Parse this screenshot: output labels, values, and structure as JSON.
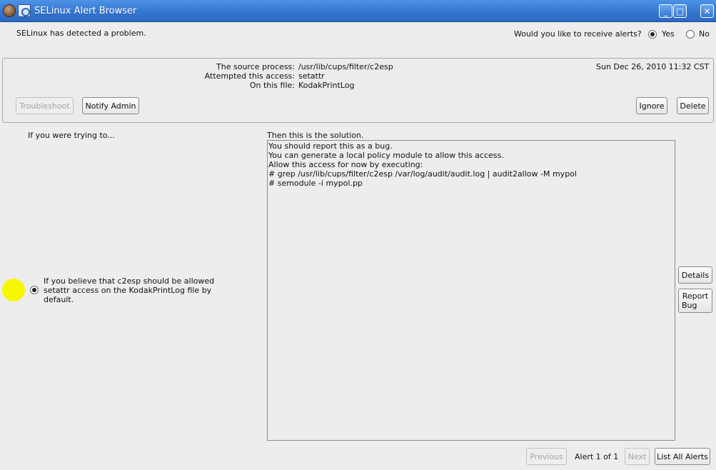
{
  "window": {
    "title": "SELinux Alert Browser",
    "minimize": "_",
    "maximize": "□",
    "close": "✕"
  },
  "header": {
    "detected": "SELinux has detected a problem.",
    "alerts_question": "Would you like to receive alerts?",
    "yes_label": "Yes",
    "no_label": "No",
    "selected": "Yes"
  },
  "alert": {
    "source_label": "The source process:",
    "source_value": "/usr/lib/cups/filter/c2esp",
    "access_label": "Attempted this access:",
    "access_value": "setattr",
    "file_label": "On this file:",
    "file_value": "KodakPrintLog",
    "date": "Sun Dec 26, 2010 11:32 CST"
  },
  "actions": {
    "troubleshoot": "Troubleshoot",
    "notify_admin": "Notify Admin",
    "ignore": "Ignore",
    "delete": "Delete"
  },
  "plugin": {
    "trying_label": "If you were trying to...",
    "solution_label": "Then this is the solution.",
    "reason": "If you believe that c2esp should be allowed setattr access on the KodakPrintLog file by default.",
    "solution_lines": [
      "You should report this as a bug.",
      "You can generate a local policy module to allow this access.",
      "Allow this access for now by executing:",
      "# grep /usr/lib/cups/filter/c2esp /var/log/audit/audit.log | audit2allow -M mypol",
      "# semodule -i mypol.pp"
    ],
    "details": "Details",
    "report_bug_line1": "Report",
    "report_bug_line2": "Bug"
  },
  "footer": {
    "previous": "Previous",
    "page_label": "Alert 1 of 1",
    "next": "Next",
    "list_all": "List All Alerts"
  },
  "colors": {
    "titlebar": "#3577d0",
    "background": "#ededed",
    "highlight_dot": "#f7f700"
  }
}
